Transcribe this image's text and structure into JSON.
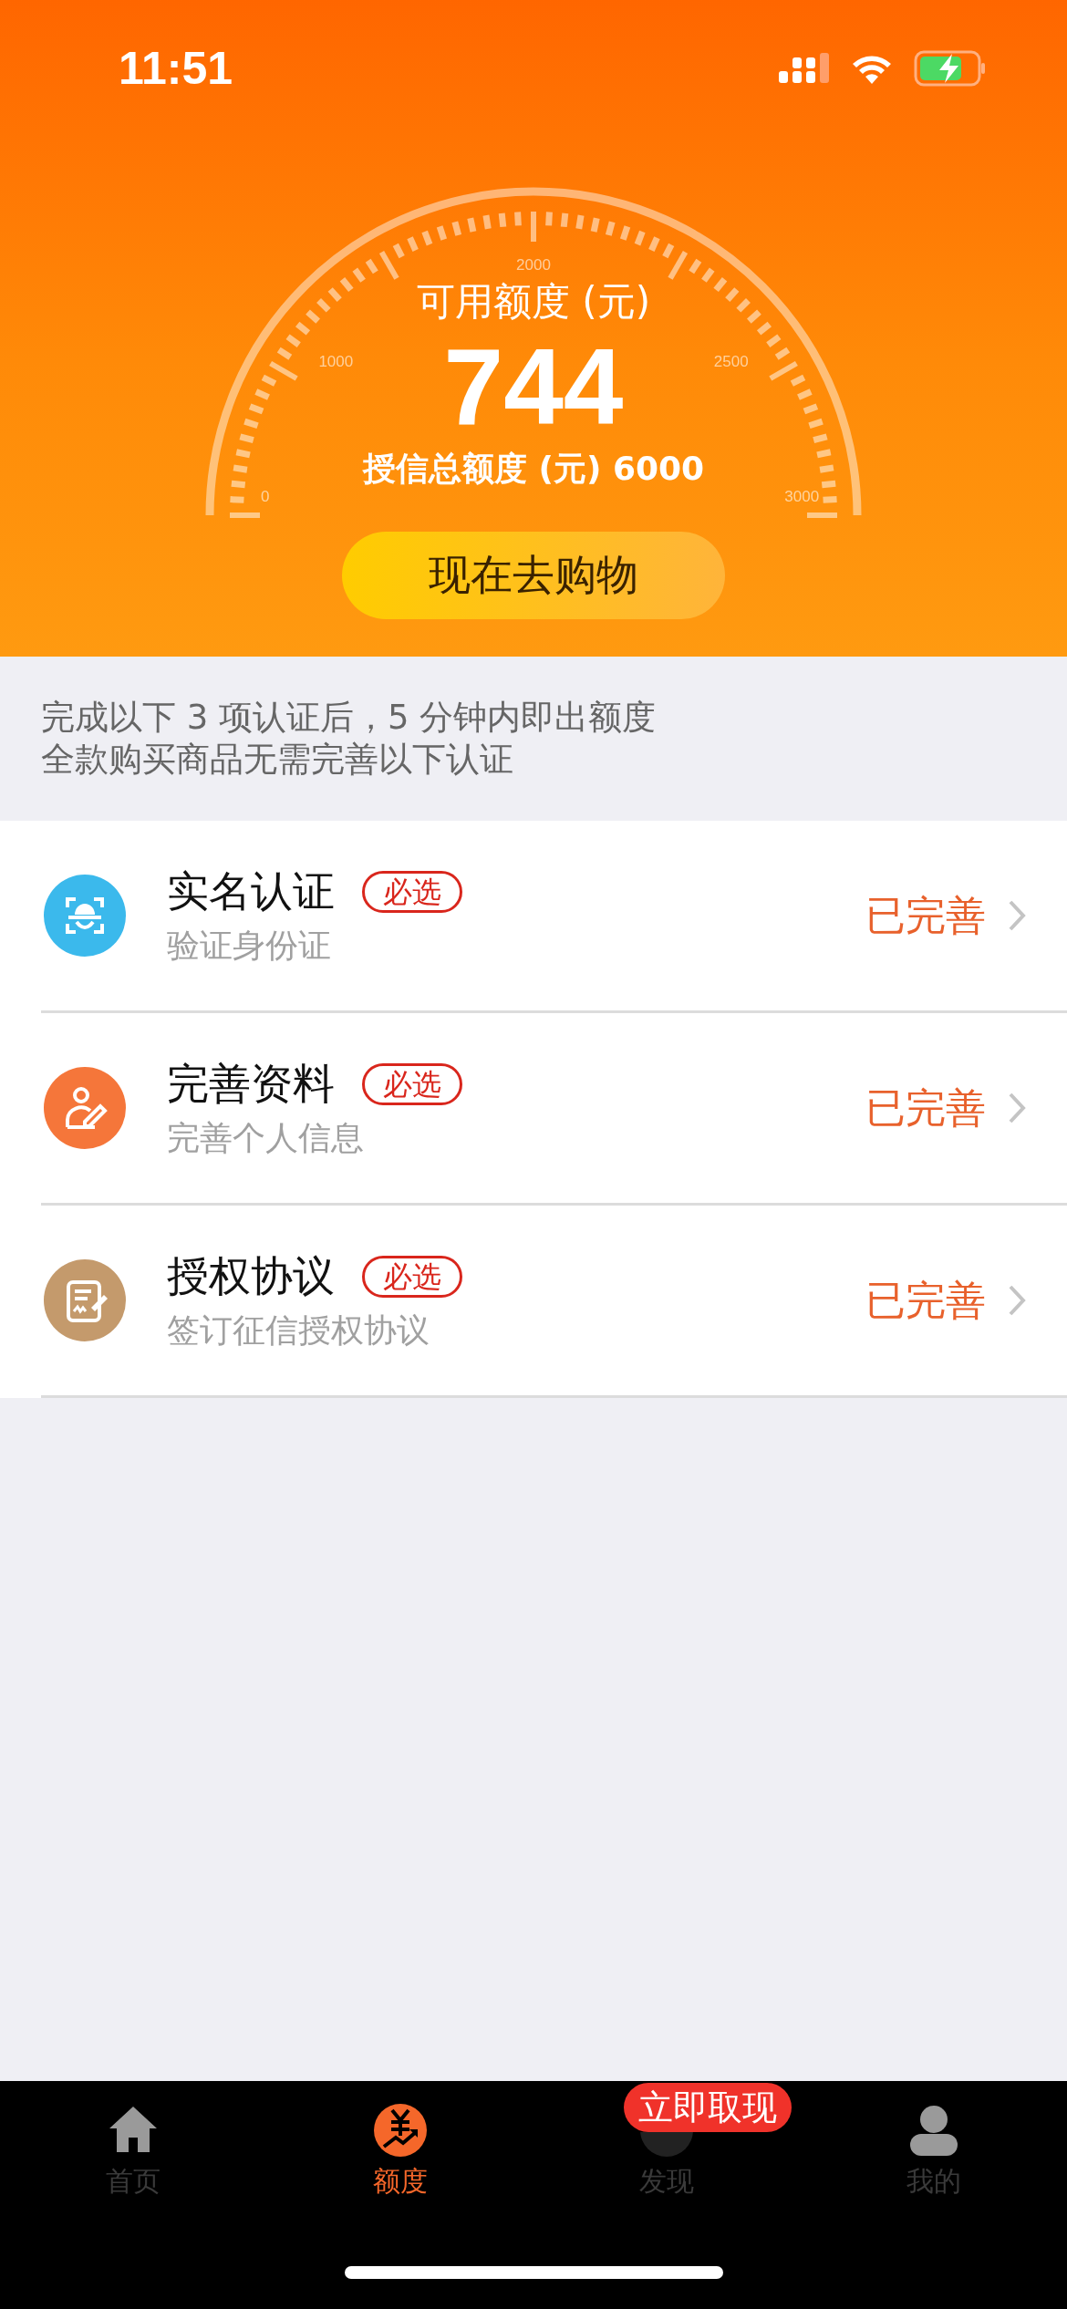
{
  "status_bar": {
    "time": "11:51"
  },
  "gauge": {
    "scale_labels": [
      "0",
      "1000",
      "2000",
      "2500",
      "3000"
    ],
    "available_label": "可用额度 (元)",
    "available": "744",
    "total_label": "授信总额度 (元) 6000"
  },
  "shop_button": "现在去购物",
  "notice": [
    "完成以下 3 项认证后，5 分钟内即出额度",
    "全款购买商品无需完善以下认证"
  ],
  "steps": [
    {
      "kind": "face",
      "color": "#3bb9ec",
      "title": "实名认证",
      "tag": "必选",
      "subtitle": "验证身份证",
      "status": "已完善"
    },
    {
      "kind": "profile",
      "color": "#f5763a",
      "title": "完善资料",
      "tag": "必选",
      "subtitle": "完善个人信息",
      "status": "已完善"
    },
    {
      "kind": "contract",
      "color": "#c49a6c",
      "title": "授权协议",
      "tag": "必选",
      "subtitle": "签订征信授权协议",
      "status": "已完善"
    }
  ],
  "tabs": [
    {
      "kind": "home",
      "label": "首页",
      "selected": false
    },
    {
      "kind": "credit",
      "label": "额度",
      "selected": true
    },
    {
      "kind": "discover",
      "label": "发现",
      "selected": false,
      "badge": "立即取现"
    },
    {
      "kind": "me",
      "label": "我的",
      "selected": false
    }
  ]
}
